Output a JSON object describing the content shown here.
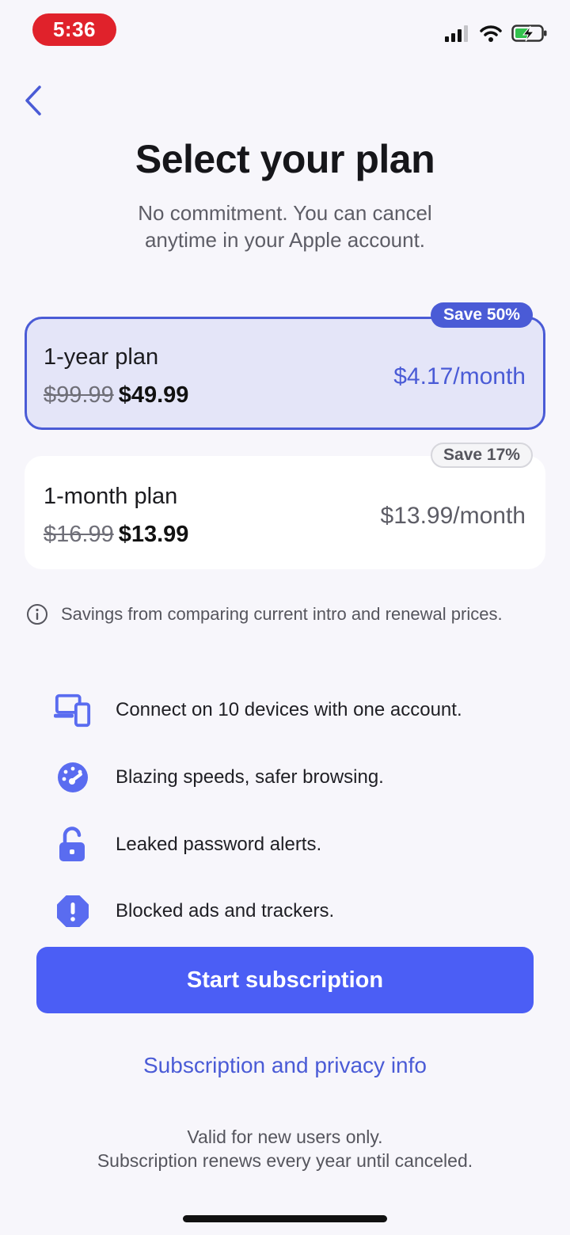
{
  "status_bar": {
    "time": "5:36",
    "icons": [
      "signal-icon",
      "wifi-icon",
      "battery-charging-icon"
    ]
  },
  "header": {
    "back_icon": "chevron-left-icon",
    "title": "Select your plan",
    "subtitle_line1": "No commitment. You can cancel",
    "subtitle_line2": "anytime in your Apple account."
  },
  "plans": [
    {
      "name": "1-year plan",
      "original_price": "$99.99",
      "price": "$49.99",
      "monthly": "$4.17/month",
      "badge": "Save 50%",
      "selected": true
    },
    {
      "name": "1-month plan",
      "original_price": "$16.99",
      "price": "$13.99",
      "monthly": "$13.99/month",
      "badge": "Save 17%",
      "selected": false
    }
  ],
  "savings_note": "Savings from comparing current intro and renewal prices.",
  "features": [
    {
      "icon": "devices-icon",
      "text": "Connect on 10 devices with one account."
    },
    {
      "icon": "speedometer-icon",
      "text": "Blazing speeds, safer browsing."
    },
    {
      "icon": "unlocked-padlock-icon",
      "text": "Leaked password alerts."
    },
    {
      "icon": "alert-octagon-icon",
      "text": "Blocked ads and trackers."
    }
  ],
  "cta_label": "Start subscription",
  "info_link": "Subscription and privacy info",
  "footnote_line1": "Valid for new users only.",
  "footnote_line2": "Subscription renews every year until canceled.",
  "colors": {
    "accent": "#4a5bd6",
    "button": "#4b5ef5",
    "selected_card_bg": "#e4e5f8",
    "time_pill": "#e0222b",
    "background": "#f7f6fb"
  }
}
